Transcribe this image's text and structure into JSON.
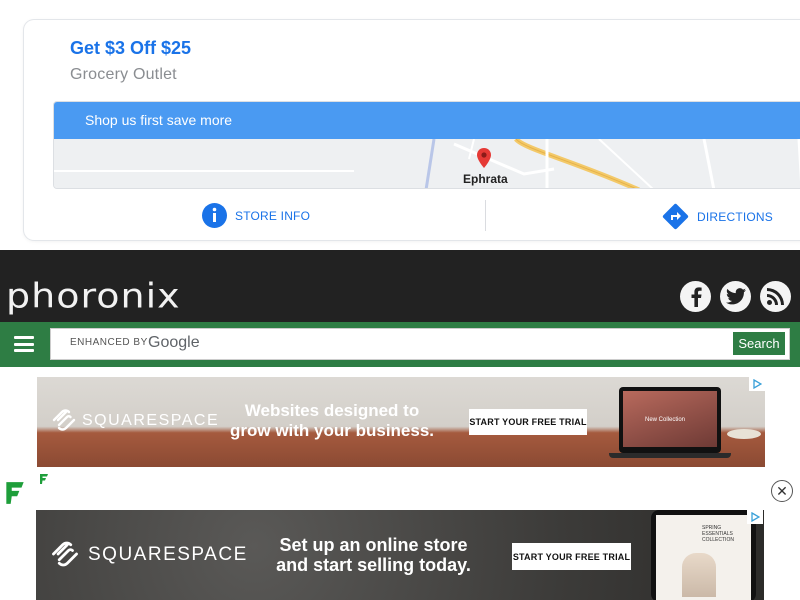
{
  "top_ad": {
    "headline": "Get $3 Off $25",
    "advertiser": "Grocery Outlet",
    "banner_text": "Shop us first save more",
    "map_place": "Ephrata",
    "store_info_label": "STORE INFO",
    "directions_label": "DIRECTIONS",
    "accent_color": "#1a73e8"
  },
  "site": {
    "logo_text": "phoronix",
    "social": [
      "facebook-icon",
      "twitter-icon",
      "rss-icon"
    ],
    "header_color": "#222222",
    "nav_color": "#2e7d44"
  },
  "search": {
    "brand_prefix": "ENHANCED BY",
    "brand_name": "Google",
    "button_label": "Search",
    "placeholder": ""
  },
  "ad1": {
    "brand": "SQUARESPACE",
    "headline_line1": "Websites designed to",
    "headline_line2": "grow with your business.",
    "cta": "START YOUR FREE TRIAL",
    "screen_caption": "New Collection"
  },
  "ad2": {
    "brand": "SQUARESPACE",
    "headline_line1": "Set up an online store",
    "headline_line2": "and start selling today.",
    "cta": "START YOUR FREE TRIAL",
    "tablet_caption": "SPRING ESSENTIALS COLLECTION"
  },
  "close_symbol": "✕"
}
